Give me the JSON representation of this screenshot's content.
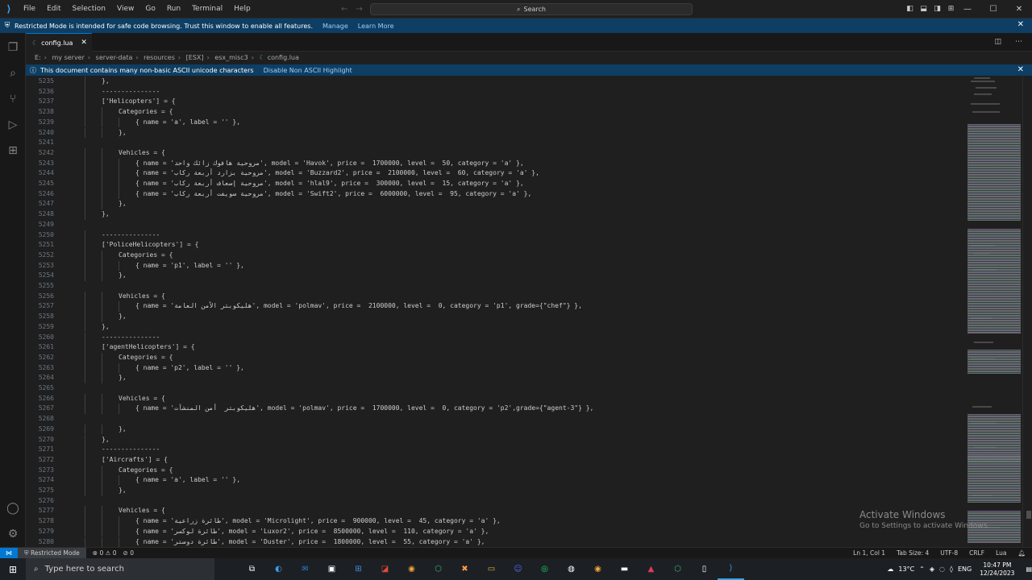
{
  "titlebar": {
    "menu": [
      "File",
      "Edit",
      "Selection",
      "View",
      "Go",
      "Run",
      "Terminal",
      "Help"
    ],
    "search_placeholder": "Search"
  },
  "restricted_banner": {
    "text": "Restricted Mode is intended for safe code browsing. Trust this window to enable all features.",
    "manage_label": "Manage",
    "learn_more_label": "Learn More"
  },
  "tab": {
    "filename": "config.lua"
  },
  "breadcrumb": [
    "E:",
    "my server",
    "server-data",
    "resources",
    "[ESX]",
    "esx_misc3",
    "config.lua"
  ],
  "unicode_banner": {
    "text": "This document contains many non-basic ASCII unicode characters",
    "action_label": "Disable Non ASCII Highlight"
  },
  "code_lines": [
    {
      "n": "5235",
      "indent": 2,
      "t": "},"
    },
    {
      "n": "5236",
      "indent": 2,
      "t": "---------------"
    },
    {
      "n": "5237",
      "indent": 2,
      "t": "['Helicopters'] = {"
    },
    {
      "n": "5238",
      "indent": 3,
      "t": "Categories = {"
    },
    {
      "n": "5239",
      "indent": 4,
      "t": "{ name = 'a', label = '' },"
    },
    {
      "n": "5240",
      "indent": 3,
      "t": "},"
    },
    {
      "n": "5241",
      "indent": 0,
      "t": ""
    },
    {
      "n": "5242",
      "indent": 3,
      "t": "Vehicles = {"
    },
    {
      "n": "5243",
      "indent": 4,
      "t": "{ name = 'مروحية هافوك زائك واحد', model = 'Havok', price =  1700000, level =  50, category = 'a' },"
    },
    {
      "n": "5244",
      "indent": 4,
      "t": "{ name = 'مروحية بزارد أربعة ركاب', model = 'Buzzard2', price =  2100000, level =  60, category = 'a' },"
    },
    {
      "n": "5245",
      "indent": 4,
      "t": "{ name = 'مروحية إسعاف أربعة ركاب', model = 'hlal9', price =  300000, level =  15, category = 'a' },"
    },
    {
      "n": "5246",
      "indent": 4,
      "t": "{ name = 'مروحية سويفت أربعة ركاب', model = 'Swift2', price =  6000000, level =  95, category = 'a' },"
    },
    {
      "n": "5247",
      "indent": 3,
      "t": "},"
    },
    {
      "n": "5248",
      "indent": 2,
      "t": "},"
    },
    {
      "n": "5249",
      "indent": 0,
      "t": ""
    },
    {
      "n": "5250",
      "indent": 2,
      "t": "---------------"
    },
    {
      "n": "5251",
      "indent": 2,
      "t": "['PoliceHelicopters'] = {"
    },
    {
      "n": "5252",
      "indent": 3,
      "t": "Categories = {"
    },
    {
      "n": "5253",
      "indent": 4,
      "t": "{ name = 'p1', label = '' },"
    },
    {
      "n": "5254",
      "indent": 3,
      "t": "},"
    },
    {
      "n": "5255",
      "indent": 0,
      "t": ""
    },
    {
      "n": "5256",
      "indent": 3,
      "t": "Vehicles = {"
    },
    {
      "n": "5257",
      "indent": 4,
      "t": "{ name = 'هليكوبتر الأمن العامة', model = 'polmav', price =  2100000, level =  0, category = 'p1', grade={\"chef\"} },"
    },
    {
      "n": "5258",
      "indent": 3,
      "t": "},"
    },
    {
      "n": "5259",
      "indent": 2,
      "t": "},"
    },
    {
      "n": "5260",
      "indent": 2,
      "t": "---------------"
    },
    {
      "n": "5261",
      "indent": 2,
      "t": "['agentHelicopters'] = {"
    },
    {
      "n": "5262",
      "indent": 3,
      "t": "Categories = {"
    },
    {
      "n": "5263",
      "indent": 4,
      "t": "{ name = 'p2', label = '' },"
    },
    {
      "n": "5264",
      "indent": 3,
      "t": "},"
    },
    {
      "n": "5265",
      "indent": 0,
      "t": ""
    },
    {
      "n": "5266",
      "indent": 3,
      "t": "Vehicles = {"
    },
    {
      "n": "5267",
      "indent": 4,
      "t": "{ name = 'هليكوبتر  أمن المنشآت', model = 'polmav', price =  1700000, level =  0, category = 'p2',grade={\"agent-3\"} },"
    },
    {
      "n": "5268",
      "indent": 0,
      "t": ""
    },
    {
      "n": "5269",
      "indent": 3,
      "t": "},"
    },
    {
      "n": "5270",
      "indent": 2,
      "t": "},"
    },
    {
      "n": "5271",
      "indent": 2,
      "t": "---------------"
    },
    {
      "n": "5272",
      "indent": 2,
      "t": "['Aircrafts'] = {"
    },
    {
      "n": "5273",
      "indent": 3,
      "t": "Categories = {"
    },
    {
      "n": "5274",
      "indent": 4,
      "t": "{ name = 'a', label = '' },"
    },
    {
      "n": "5275",
      "indent": 3,
      "t": "},"
    },
    {
      "n": "5276",
      "indent": 0,
      "t": ""
    },
    {
      "n": "5277",
      "indent": 3,
      "t": "Vehicles = {"
    },
    {
      "n": "5278",
      "indent": 4,
      "t": "{ name = 'طائرة زراعية', model = 'Microlight', price =  900000, level =  45, category = 'a' },"
    },
    {
      "n": "5279",
      "indent": 4,
      "t": "{ name = 'طائرة لوكسر', model = 'Luxor2', price =  8500000, level =  110, category = 'a' },"
    },
    {
      "n": "5280",
      "indent": 4,
      "t": "{ name = 'طائرة دوستر', model = 'Duster', price =  1800000, level =  55, category = 'a' },"
    }
  ],
  "watermark": {
    "title": "Activate Windows",
    "subtitle": "Go to Settings to activate Windows."
  },
  "statusbar": {
    "mode": "Restricted Mode",
    "errors": "0",
    "warnings": "0",
    "ports": "0",
    "position": "Ln 1, Col 1",
    "tab_size": "Tab Size: 4",
    "encoding": "UTF-8",
    "eol": "CRLF",
    "language": "Lua"
  },
  "taskbar": {
    "search_placeholder": "Type here to search",
    "weather": "13°C",
    "language": "ENG",
    "time": "10:47 PM",
    "date": "12/24/2023"
  }
}
